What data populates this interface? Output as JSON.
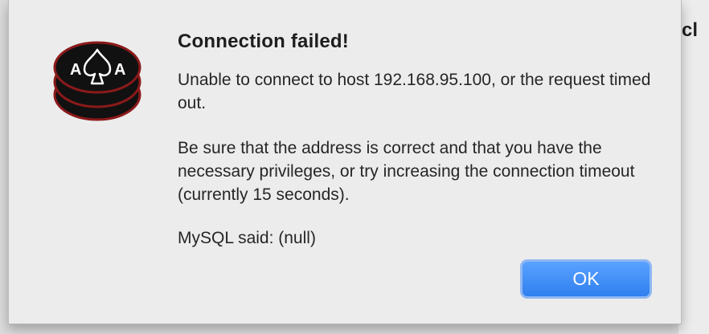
{
  "background_app": {
    "partial_text": "r cl"
  },
  "dialog": {
    "icon_name": "poker-chip-ace-icon",
    "icon_letters": [
      "A",
      "A"
    ],
    "title": "Connection failed!",
    "message_line1": "Unable to connect to host 192.168.95.100, or the request timed out.",
    "message_line2": "Be sure that the address is correct and that you have the necessary privileges, or try increasing the connection timeout (currently 15 seconds).",
    "message_line3": "MySQL said: (null)",
    "ok_label": "OK"
  },
  "colors": {
    "dialog_bg": "#ececec",
    "button_accent": "#2f7fef",
    "chip_red": "#8b1a1a",
    "chip_black": "#111111"
  }
}
